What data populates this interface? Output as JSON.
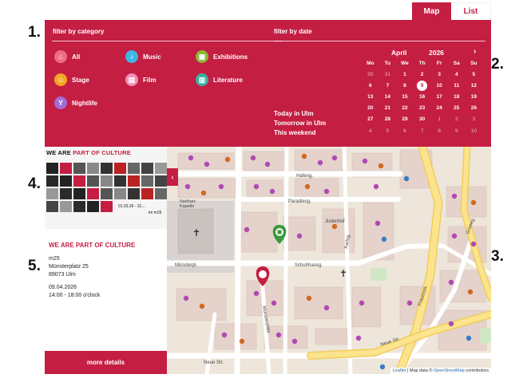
{
  "steps": [
    "1.",
    "2.",
    "3.",
    "4.",
    "5."
  ],
  "view_tabs": {
    "map": "Map",
    "list": "List"
  },
  "filters": {
    "category_title": "filter by category",
    "date_title": "filter by date",
    "categories": [
      {
        "label": "All",
        "icon": "tag-icon",
        "color": "#ec6d84"
      },
      {
        "label": "Music",
        "icon": "music-note-icon",
        "color": "#3bb7e5"
      },
      {
        "label": "Exhibitions",
        "icon": "gallery-icon",
        "color": "#8ab832"
      },
      {
        "label": "Stage",
        "icon": "mask-icon",
        "color": "#f5a623"
      },
      {
        "label": "Film",
        "icon": "film-icon",
        "color": "#f08fb6"
      },
      {
        "label": "Literature",
        "icon": "book-icon",
        "color": "#3ab1a2"
      },
      {
        "label": "Nightlife",
        "icon": "cocktail-icon",
        "color": "#a36cd5"
      }
    ],
    "quick_dates": [
      "Today in Ulm",
      "Tomorrow in Ulm",
      "This weekend"
    ]
  },
  "calendar": {
    "month": "April",
    "year": "2026",
    "weekdays": [
      "Mo",
      "Tu",
      "We",
      "Th",
      "Fr",
      "Sa",
      "Su"
    ],
    "days": [
      "30",
      "31",
      "1",
      "2",
      "3",
      "4",
      "5",
      "6",
      "7",
      "8",
      "9",
      "10",
      "11",
      "12",
      "13",
      "14",
      "15",
      "16",
      "17",
      "18",
      "19",
      "20",
      "21",
      "22",
      "23",
      "24",
      "25",
      "26",
      "27",
      "28",
      "29",
      "30",
      "1",
      "2",
      "3",
      "4",
      "5",
      "6",
      "7",
      "8",
      "9",
      "10"
    ],
    "muted_indices": [
      0,
      1,
      32,
      33,
      34,
      35,
      36,
      37,
      38,
      39,
      40,
      41
    ],
    "today_index": 10
  },
  "event": {
    "poster_text": "WE ARE PART OF CULTURE",
    "poster_date": "01.03.26 - 31...",
    "poster_venue": "im m25",
    "title": "WE ARE PART OF CULTURE",
    "venue": "m25",
    "street": "Münsterplatz 25",
    "city": "89073 Ulm",
    "date": "09.04.2026",
    "time": "14:00 - 18:00 o'clock",
    "more_label": "more details"
  },
  "map": {
    "attribution_leaflet": "Leaflet",
    "attribution_text": " | Map data © ",
    "attribution_osm": "OpenStreetMap",
    "attribution_tail": " contributors",
    "street_labels": [
      "Hafeng.",
      "Paradiesg.",
      "Judenhof",
      "Schuhhausg.",
      "Münsterpl.",
      "Münsterplatz",
      "Neue Str.",
      "Neue Str.",
      "Frauenstr.",
      "Karlsg.",
      "Grüneg."
    ],
    "place_labels": [
      "Neithart-Kapelle"
    ],
    "colors": {
      "accent": "#c41e43",
      "marker_green": "#3a9a3a"
    }
  }
}
